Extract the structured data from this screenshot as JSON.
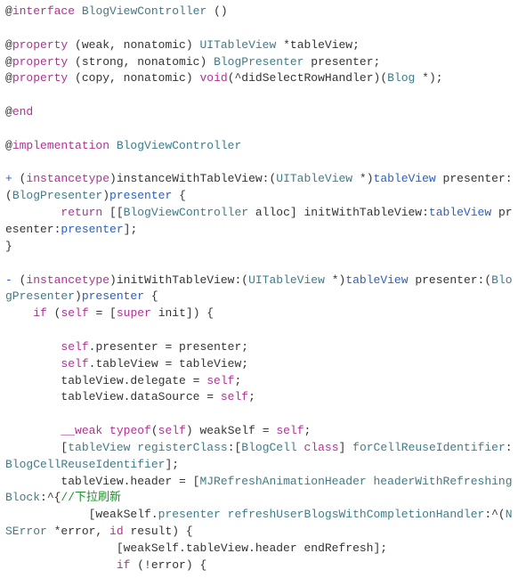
{
  "code": {
    "l01": {
      "at": "@",
      "kw_interface": "interface",
      "cls": "BlogViewController",
      "tail": " ()"
    },
    "l02": {
      "at": "@",
      "kw_prop": "property",
      "attrs": " (weak, nonatomic) ",
      "type": "UITableView",
      "rest": " *tableView;"
    },
    "l03": {
      "at": "@",
      "kw_prop": "property",
      "attrs": " (strong, nonatomic) ",
      "type": "BlogPresenter",
      "rest": " presenter;"
    },
    "l04": {
      "at": "@",
      "kw_prop": "property",
      "attrs": " (copy, nonatomic) ",
      "kw_void": "void",
      "mid": "(^didSelectRowHandler)(",
      "type": "Blog",
      "rest": " *);"
    },
    "l05": {
      "at": "@",
      "kw_end": "end"
    },
    "l06": {
      "at": "@",
      "kw_impl": "implementation",
      "cls": " BlogViewController"
    },
    "l07": {
      "sign": "+ ",
      "p1": "(",
      "kw_inst": "instancetype",
      "p2": ")instanceWithTableView:(",
      "type1": "UITableView",
      "star": " *)",
      "param1": "tableView",
      "sel2": " presenter:(",
      "type2": "BlogPresenter",
      "p3": ")",
      "param2": "presenter",
      "brace": " {"
    },
    "l08": {
      "indent": "        ",
      "kw_return": "return",
      "mid1": " [[",
      "cls": "BlogViewController",
      "mid2": " alloc] initWithTableView:",
      "arg1": "tableView",
      "mid3": " presenter:",
      "arg2": "presenter",
      "end": "];"
    },
    "l09": {
      "txt": "}"
    },
    "l10": {
      "sign": "- ",
      "p1": "(",
      "kw_inst": "instancetype",
      "p2": ")initWithTableView:(",
      "type1": "UITableView",
      "star": " *)",
      "param1": "tableView",
      "sel2": " presenter:(",
      "type2": "BlogPresenter",
      "p3": ")",
      "param2": "presenter",
      "brace": " {"
    },
    "l11": {
      "indent": "    ",
      "kw_if": "if",
      "mid": " (",
      "kw_self": "self",
      "mid2": " = [",
      "kw_super": "super",
      "mid3": " init]) {"
    },
    "l12": {
      "indent": "        ",
      "kw_self": "self",
      "rest": ".presenter = presenter;"
    },
    "l13": {
      "indent": "        ",
      "kw_self": "self",
      "rest": ".tableView = tableView;"
    },
    "l14": {
      "indent": "        ",
      "txt": "tableView.delegate = ",
      "kw_self": "self",
      "end": ";"
    },
    "l15": {
      "indent": "        ",
      "txt": "tableView.dataSource = ",
      "kw_self": "self",
      "end": ";"
    },
    "l16": {
      "indent": "        ",
      "kw_weak": "__weak",
      "sp": " ",
      "kw_typeof": "typeof",
      "mid": "(",
      "kw_self": "self",
      "mid2": ") weakSelf = ",
      "kw_self2": "self",
      "end": ";"
    },
    "l17": {
      "indent": "        ",
      "open": "[",
      "recv": "tableView",
      "sp": " ",
      "msg": "registerClass",
      "colon": ":[",
      "cls": "BlogCell",
      "sp2": " ",
      "kw_class": "class",
      "close": "] "
    },
    "l17b": {
      "msg": "forCellReuseIdentifier",
      "colon": ":",
      "arg": "BlogCellReuseIdentifier",
      "end": "];"
    },
    "l18": {
      "indent": "        ",
      "lhs": "tableView.header = [",
      "cls": "MJRefreshAnimationHeader",
      "sp": " ",
      "msg": "headerWithRefreshingBlock",
      "colon": ":^{",
      "com": "//下拉刷新"
    },
    "l19": {
      "indent": "            ",
      "open": "[weakSelf.",
      "prop": "presenter",
      "sp": " ",
      "msg": "refreshUserBlogsWithCompletionHandler",
      "colon": ":^(",
      "type": "NSError",
      "mid": " *error, ",
      "kw_id": "id",
      "rest": " result) {"
    },
    "l20": {
      "indent": "                ",
      "txt": "[weakSelf.tableView.header endRefresh];"
    },
    "l21": {
      "indent": "                ",
      "kw_if": "if",
      "mid": " (!error) {"
    }
  }
}
